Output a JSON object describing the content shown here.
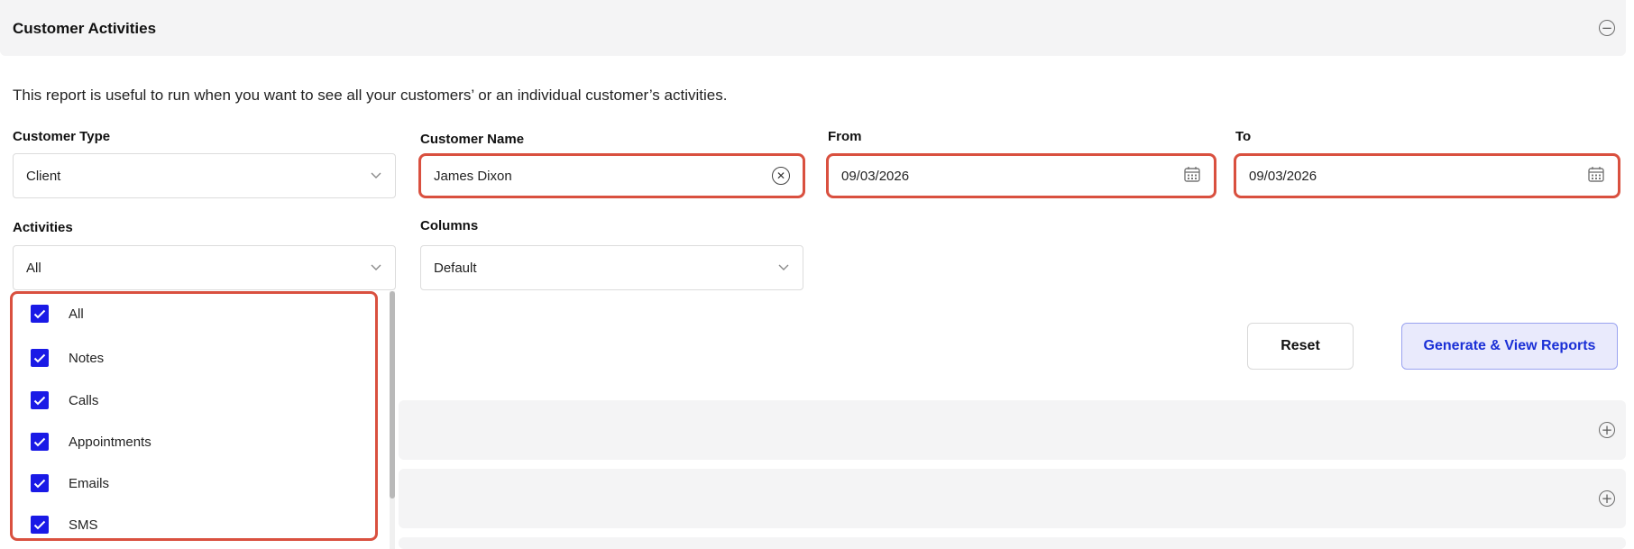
{
  "section": {
    "title": "Customer Activities",
    "description": "This report is useful to run when you want to see all your customers’ or an individual customer’s activities."
  },
  "filters": {
    "customer_type": {
      "label": "Customer Type",
      "value": "Client"
    },
    "customer_name": {
      "label": "Customer Name",
      "value": "James Dixon"
    },
    "from": {
      "label": "From",
      "value": "09/03/2026"
    },
    "to": {
      "label": "To",
      "value": "09/03/2026"
    },
    "activities": {
      "label": "Activities",
      "value": "All",
      "options": [
        {
          "label": "All",
          "checked": true
        },
        {
          "label": "Notes",
          "checked": true
        },
        {
          "label": "Calls",
          "checked": true
        },
        {
          "label": "Appointments",
          "checked": true
        },
        {
          "label": "Emails",
          "checked": true
        },
        {
          "label": "SMS",
          "checked": true
        }
      ]
    },
    "columns": {
      "label": "Columns",
      "value": "Default"
    }
  },
  "actions": {
    "reset_label": "Reset",
    "generate_label": "Generate & View Reports"
  },
  "icons": {
    "collapse": "minus-circle-icon",
    "expand": "plus-circle-icon",
    "clear": "clear-x-icon",
    "calendar": "calendar-icon",
    "chevron": "chevron-down-icon",
    "checkbox": "checkbox-checked-icon"
  },
  "colors": {
    "highlight": "#d9503f",
    "checkbox": "#1a1ae6",
    "primary_text": "#1a2fd6",
    "primary_bg": "#e9eafc",
    "header_bg": "#f4f4f5"
  }
}
